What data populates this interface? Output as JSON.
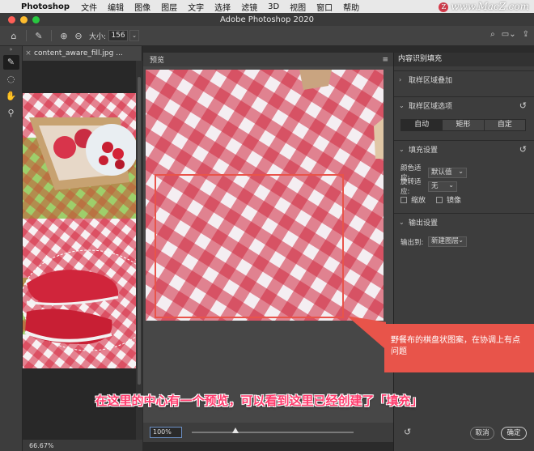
{
  "menubar": {
    "app_name": "Photoshop",
    "items": [
      "文件",
      "编辑",
      "图像",
      "图层",
      "文字",
      "选择",
      "滤镜",
      "3D",
      "视图",
      "窗口",
      "帮助"
    ],
    "watermark": "www.MacZ.com",
    "watermark_badge": "Z"
  },
  "window": {
    "title": "Adobe Photoshop 2020",
    "traffic_colors": [
      "#fe5f57",
      "#febc2e",
      "#28c840"
    ]
  },
  "options": {
    "size_label": "大小:",
    "size_value": "156"
  },
  "document": {
    "tab_name": "content_aware_fill.jpg ...",
    "zoom_status": "66.67%"
  },
  "preview": {
    "label": "预览",
    "zoom_value": "100%"
  },
  "panel": {
    "title": "内容识别填充",
    "section_overlay": "取样区域叠加",
    "section_sampling": "取样区域选项",
    "sampling_modes": [
      "自动",
      "矩形",
      "自定"
    ],
    "section_fill": "填充设置",
    "color_adapt_label": "颜色适应:",
    "color_adapt_value": "默认值",
    "rotate_adapt_label": "旋转适应:",
    "rotate_adapt_value": "无",
    "scale_label": "缩放",
    "mirror_label": "镜像",
    "section_output": "输出设置",
    "output_to_label": "输出到:",
    "output_to_value": "新建图层",
    "cancel_label": "取消",
    "ok_label": "确定"
  },
  "annotations": {
    "callout": "野餐布的棋盘状图案，在协调上有点问题",
    "caption": "在这里的中心有一个预览，可以看到这里已经创建了「填充」",
    "callout_color": "#e8544a",
    "caption_color": "#ff3a6c"
  }
}
